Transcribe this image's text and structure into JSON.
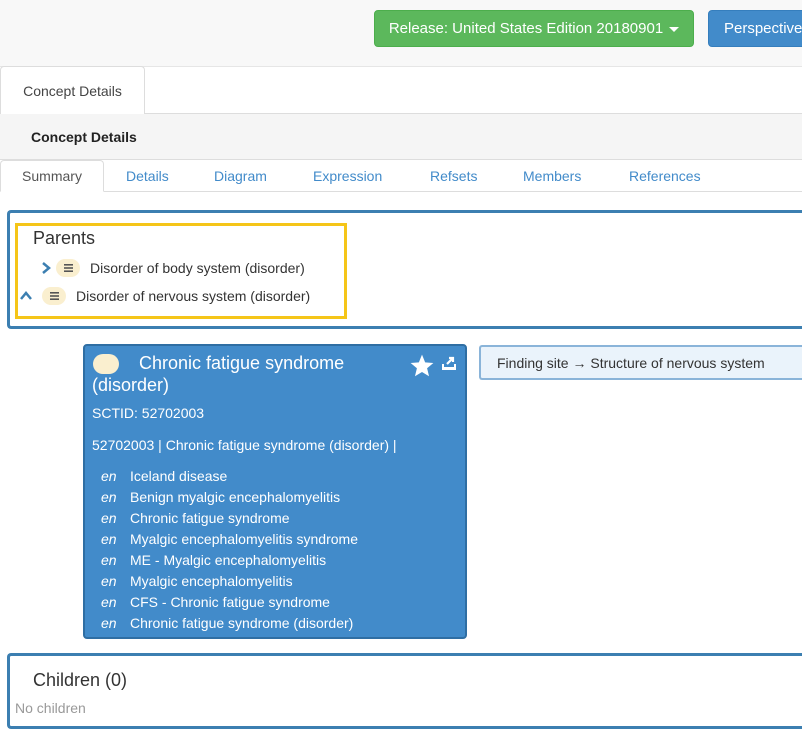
{
  "header": {
    "release_label": "Release: United States Edition 20180901",
    "perspectives_label": "Perspectives"
  },
  "outer_tab": {
    "label": "Concept Details"
  },
  "panel": {
    "title": "Concept Details"
  },
  "tabs": [
    {
      "label": "Summary",
      "active": true
    },
    {
      "label": "Details"
    },
    {
      "label": "Diagram"
    },
    {
      "label": "Expression"
    },
    {
      "label": "Refsets"
    },
    {
      "label": "Members"
    },
    {
      "label": "References"
    }
  ],
  "parents": {
    "title": "Parents",
    "items": [
      {
        "label": "Disorder of body system (disorder)",
        "icon": "chevron-right-icon"
      },
      {
        "label": "Disorder of nervous system (disorder)",
        "icon": "chevron-up-icon"
      }
    ]
  },
  "concept": {
    "title": "Chronic fatigue syndrome (disorder)",
    "sctid_line": "SCTID: 52702003",
    "fsn_line": "52702003 | Chronic fatigue syndrome (disorder) |",
    "synonyms": [
      {
        "lang": "en",
        "term": "Iceland disease"
      },
      {
        "lang": "en",
        "term": "Benign myalgic encephalomyelitis"
      },
      {
        "lang": "en",
        "term": "Chronic fatigue syndrome"
      },
      {
        "lang": "en",
        "term": "Myalgic encephalomyelitis syndrome"
      },
      {
        "lang": "en",
        "term": "ME - Myalgic encephalomyelitis"
      },
      {
        "lang": "en",
        "term": "Myalgic encephalomyelitis"
      },
      {
        "lang": "en",
        "term": "CFS - Chronic fatigue syndrome"
      },
      {
        "lang": "en",
        "term": "Chronic fatigue syndrome (disorder)"
      }
    ]
  },
  "attribute": {
    "text": "Finding site →  Structure of nervous system"
  },
  "children": {
    "title": "Children (0)",
    "empty_text": "No children"
  },
  "colors": {
    "release_green": "#5cb85c",
    "primary_blue": "#428bca",
    "highlight_yellow": "#f5c518",
    "badge_cream": "#faefcf"
  }
}
